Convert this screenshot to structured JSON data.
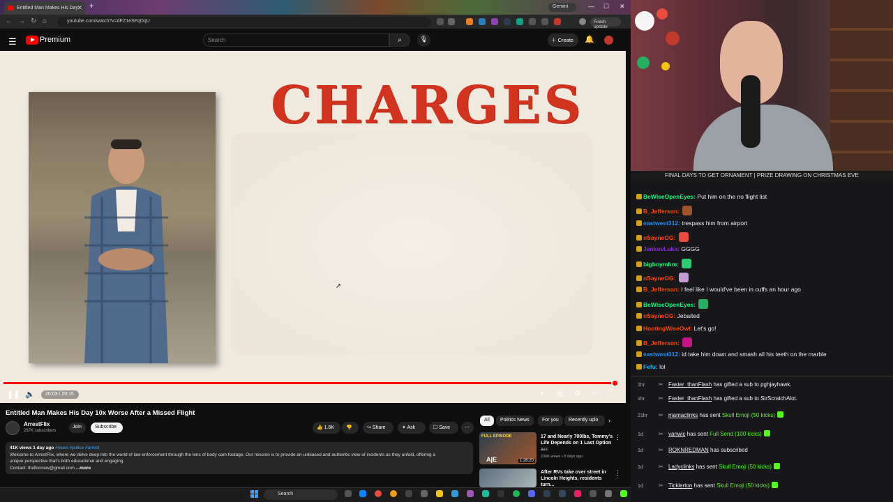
{
  "browser": {
    "tab_title": "Entitled Man Makes His Day",
    "gemini_label": "Gemini",
    "url": "youtube.com/watch?v=dFZ1eSFqDqU",
    "finish_update_label": "Finish update"
  },
  "youtube": {
    "logo_text": "Premium",
    "search_placeholder": "Search",
    "create_label": "Create"
  },
  "video": {
    "overlay_text": "CHARGES",
    "time": "20:03 / 20:15",
    "progress": 0.99,
    "title": "Entitled Man Makes His Day 10x Worse After a Missed Flight"
  },
  "channel": {
    "name": "ArrestFlix",
    "subscribers": "267K subscribers",
    "join_label": "Join",
    "subscribe_label": "Subscribe"
  },
  "actions": {
    "likes": "1.6K",
    "share_label": "Share",
    "ask_label": "Ask",
    "save_label": "Save"
  },
  "description": {
    "stats": "41K views  1 day ago",
    "hashtags": "#news #police #arrest",
    "line1": "Welcome to ArrestFlix, where we delve deep into the world of law enforcement through the lens of body cam footage. Our mission is to provide an unbiased and authentic view of incidents as they unfold, offering a",
    "line2": "unique perspective that's both educational and engaging.",
    "line3": "Contact: theflixcrew@gmail.com",
    "more": "...more"
  },
  "recommendations": {
    "chips": [
      "All",
      "Politics News",
      "For you",
      "Recently uplo"
    ],
    "items": [
      {
        "title": "17 and Nearly 700lbs, Tommy's Life Depends on 1 Last Option ...",
        "channel": "A&E",
        "meta": "236K views • 9 days ago",
        "duration": "1:26:20",
        "thumb_text": "FULL EPISODE"
      },
      {
        "title": "After RVs take over street in Lincoln Heights, residents turn...",
        "channel": "",
        "meta": "",
        "duration": "",
        "thumb_text": ""
      }
    ]
  },
  "taskbar": {
    "search_label": "Search"
  },
  "stream": {
    "banner": "FINAL DAYS TO GET ORNAMENT | PRIZE DRAWING ON CHRISTMAS EVE",
    "chat": [
      {
        "user": "BeWiseOpenEyes:",
        "text": "Put him on the no flight list",
        "color": "#00ff7f"
      },
      {
        "user": "B_Jefferson:",
        "text": "",
        "color": "#ff4500"
      },
      {
        "user": "eastwest312:",
        "text": "trespass him from airport",
        "color": "#1e90ff"
      },
      {
        "user": "nSayneOG:",
        "text": "",
        "color": "#ff4500"
      },
      {
        "user": "JankovLuka:",
        "text": "GGGG",
        "color": "#8a2be2"
      },
      {
        "user": "bigboymhm:",
        "text": "",
        "color": "#00ff7f"
      },
      {
        "user": "nSayneOG:",
        "text": "",
        "color": "#ff4500"
      },
      {
        "user": "B_Jefferson:",
        "text": "I feel like I would've been in cuffs an hour ago",
        "color": "#ff4500"
      },
      {
        "user": "BeWiseOpenEyes:",
        "text": "",
        "color": "#00ff7f"
      },
      {
        "user": "nSayneOG:",
        "text": "Jebaited",
        "color": "#ff4500"
      },
      {
        "user": "HootingWiseOwl:",
        "text": "Let's go!",
        "color": "#ff4500"
      },
      {
        "user": "B_Jefferson:",
        "text": "",
        "color": "#ff4500"
      },
      {
        "user": "eastwest312:",
        "text": "id take him down and smash all his teeth on the marble",
        "color": "#1e90ff"
      },
      {
        "user": "Fefu:",
        "text": "lol",
        "color": "#00bfff"
      }
    ],
    "alerts": [
      {
        "time": "1hr",
        "user": "Faster_thanFlash",
        "mid": "has gifted a sub to",
        "target": "pghjayhawk."
      },
      {
        "time": "1hr",
        "user": "Faster_thanFlash",
        "mid": "has gifted a sub to",
        "target": "SirScratchAlot."
      },
      {
        "time": "21hr",
        "user": "mamaclinks",
        "mid": "has sent",
        "target": "Skull Emoji (50 kicks)"
      },
      {
        "time": "1d",
        "user": "vanwic",
        "mid": "has sent",
        "target": "Full Send (100 kicks)"
      },
      {
        "time": "1d",
        "user": "ROKNREDMAN",
        "mid": "has subscribed",
        "target": ""
      },
      {
        "time": "1d",
        "user": "Ladyclinks",
        "mid": "has sent",
        "target": "Skull Emoji (50 kicks)"
      },
      {
        "time": "1d",
        "user": "Ticklerton",
        "mid": "has sent",
        "target": "Skull Emoji (50 kicks)"
      }
    ]
  }
}
